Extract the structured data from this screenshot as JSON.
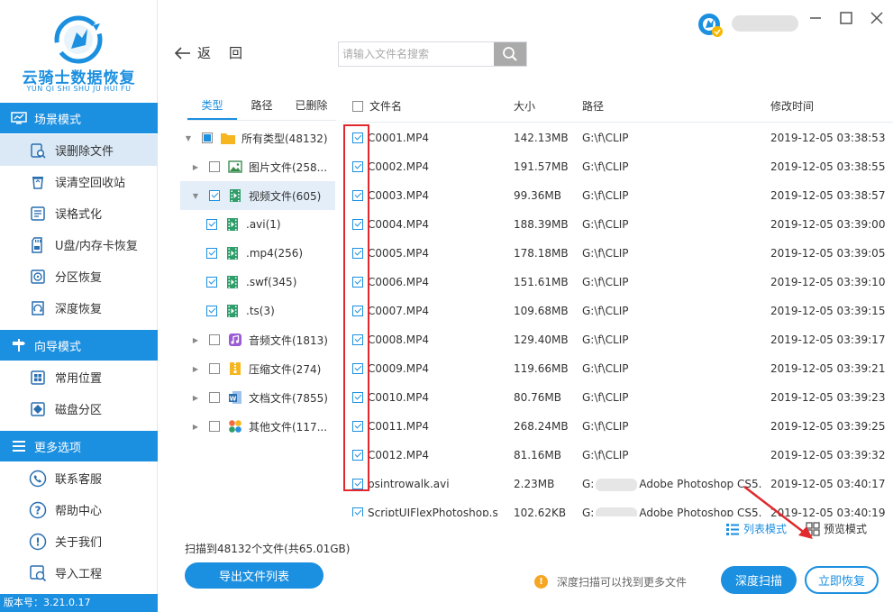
{
  "app": {
    "name": "云骑士数据恢复",
    "pinyin": "YUN QI SHI SHU JU HUI FU",
    "version": "版本号：3.21.0.17"
  },
  "sidebar": {
    "sections": [
      {
        "title": "场景模式",
        "items": [
          "误删除文件",
          "误清空回收站",
          "误格式化",
          "U盘/内存卡恢复",
          "分区恢复",
          "深度恢复"
        ]
      },
      {
        "title": "向导模式",
        "items": [
          "常用位置",
          "磁盘分区"
        ]
      },
      {
        "title": "更多选项",
        "items": [
          "联系客服",
          "帮助中心",
          "关于我们",
          "导入工程"
        ]
      }
    ],
    "active_item": "误删除文件"
  },
  "toolbar": {
    "back_label": "返回",
    "search_placeholder": "请输入文件名搜索"
  },
  "tree": {
    "tabs": [
      "类型",
      "路径",
      "已删除"
    ],
    "active_tab": "类型",
    "nodes": [
      {
        "label": "所有类型(48132)",
        "level": 0,
        "arrow": "▼",
        "check": "partial",
        "icon": "folder-icon"
      },
      {
        "label": "图片文件(258...",
        "level": 1,
        "arrow": "▶",
        "check": "none",
        "icon": "image-file-icon"
      },
      {
        "label": "视频文件(605)",
        "level": 1,
        "arrow": "▼",
        "check": "checked",
        "icon": "video-file-icon",
        "selected": true
      },
      {
        "label": ".avi(1)",
        "level": 2,
        "arrow": "",
        "check": "checked",
        "icon": "video-file-icon"
      },
      {
        "label": ".mp4(256)",
        "level": 2,
        "arrow": "",
        "check": "checked",
        "icon": "video-file-icon"
      },
      {
        "label": ".swf(345)",
        "level": 2,
        "arrow": "",
        "check": "checked",
        "icon": "video-file-icon"
      },
      {
        "label": ".ts(3)",
        "level": 2,
        "arrow": "",
        "check": "checked",
        "icon": "video-file-icon"
      },
      {
        "label": "音频文件(1813)",
        "level": 1,
        "arrow": "▶",
        "check": "none",
        "icon": "audio-file-icon"
      },
      {
        "label": "压缩文件(274)",
        "level": 1,
        "arrow": "▶",
        "check": "none",
        "icon": "archive-file-icon"
      },
      {
        "label": "文档文件(7855)",
        "level": 1,
        "arrow": "▶",
        "check": "none",
        "icon": "document-file-icon"
      },
      {
        "label": "其他文件(117...",
        "level": 1,
        "arrow": "▶",
        "check": "none",
        "icon": "other-file-icon"
      }
    ]
  },
  "table": {
    "columns": [
      "文件名",
      "大小",
      "路径",
      "修改时间"
    ],
    "rows": [
      {
        "name": "C0001.MP4",
        "size": "142.13MB",
        "path": "G:\\f\\CLIP",
        "time": "2019-12-05 03:38:53"
      },
      {
        "name": "C0002.MP4",
        "size": "191.57MB",
        "path": "G:\\f\\CLIP",
        "time": "2019-12-05 03:38:55"
      },
      {
        "name": "C0003.MP4",
        "size": "99.36MB",
        "path": "G:\\f\\CLIP",
        "time": "2019-12-05 03:38:57"
      },
      {
        "name": "C0004.MP4",
        "size": "188.39MB",
        "path": "G:\\f\\CLIP",
        "time": "2019-12-05 03:39:00"
      },
      {
        "name": "C0005.MP4",
        "size": "178.18MB",
        "path": "G:\\f\\CLIP",
        "time": "2019-12-05 03:39:05"
      },
      {
        "name": "C0006.MP4",
        "size": "151.61MB",
        "path": "G:\\f\\CLIP",
        "time": "2019-12-05 03:39:10"
      },
      {
        "name": "C0007.MP4",
        "size": "109.68MB",
        "path": "G:\\f\\CLIP",
        "time": "2019-12-05 03:39:15"
      },
      {
        "name": "C0008.MP4",
        "size": "129.40MB",
        "path": "G:\\f\\CLIP",
        "time": "2019-12-05 03:39:17"
      },
      {
        "name": "C0009.MP4",
        "size": "119.66MB",
        "path": "G:\\f\\CLIP",
        "time": "2019-12-05 03:39:21"
      },
      {
        "name": "C0010.MP4",
        "size": "80.76MB",
        "path": "G:\\f\\CLIP",
        "time": "2019-12-05 03:39:23"
      },
      {
        "name": "C0011.MP4",
        "size": "268.24MB",
        "path": "G:\\f\\CLIP",
        "time": "2019-12-05 03:39:25"
      },
      {
        "name": "C0012.MP4",
        "size": "81.16MB",
        "path": "G:\\f\\CLIP",
        "time": "2019-12-05 03:39:32"
      },
      {
        "name": "psintrowalk.avi",
        "size": "2.23MB",
        "path_prefix": "G:",
        "path": "Adobe Photoshop CS5...",
        "time": "2019-12-05 03:40:17"
      },
      {
        "name": "ScriptUIFlexPhotoshop.s",
        "size": "102.62KB",
        "path_prefix": "G:",
        "path": "Adobe Photoshop CS5...",
        "time": "2019-12-05 03:40:19"
      }
    ]
  },
  "view_modes": {
    "list": "列表模式",
    "preview": "预览模式",
    "active": "list"
  },
  "footer": {
    "scan_summary": "扫描到48132个文件(共65.01GB)",
    "export_label": "导出文件列表",
    "tip": "深度扫描可以找到更多文件",
    "deep_scan_label": "深度扫描",
    "recover_label": "立即恢复"
  },
  "colors": {
    "accent": "#1b8fe0",
    "highlight": "#e0282d",
    "warning": "#f5a623"
  }
}
